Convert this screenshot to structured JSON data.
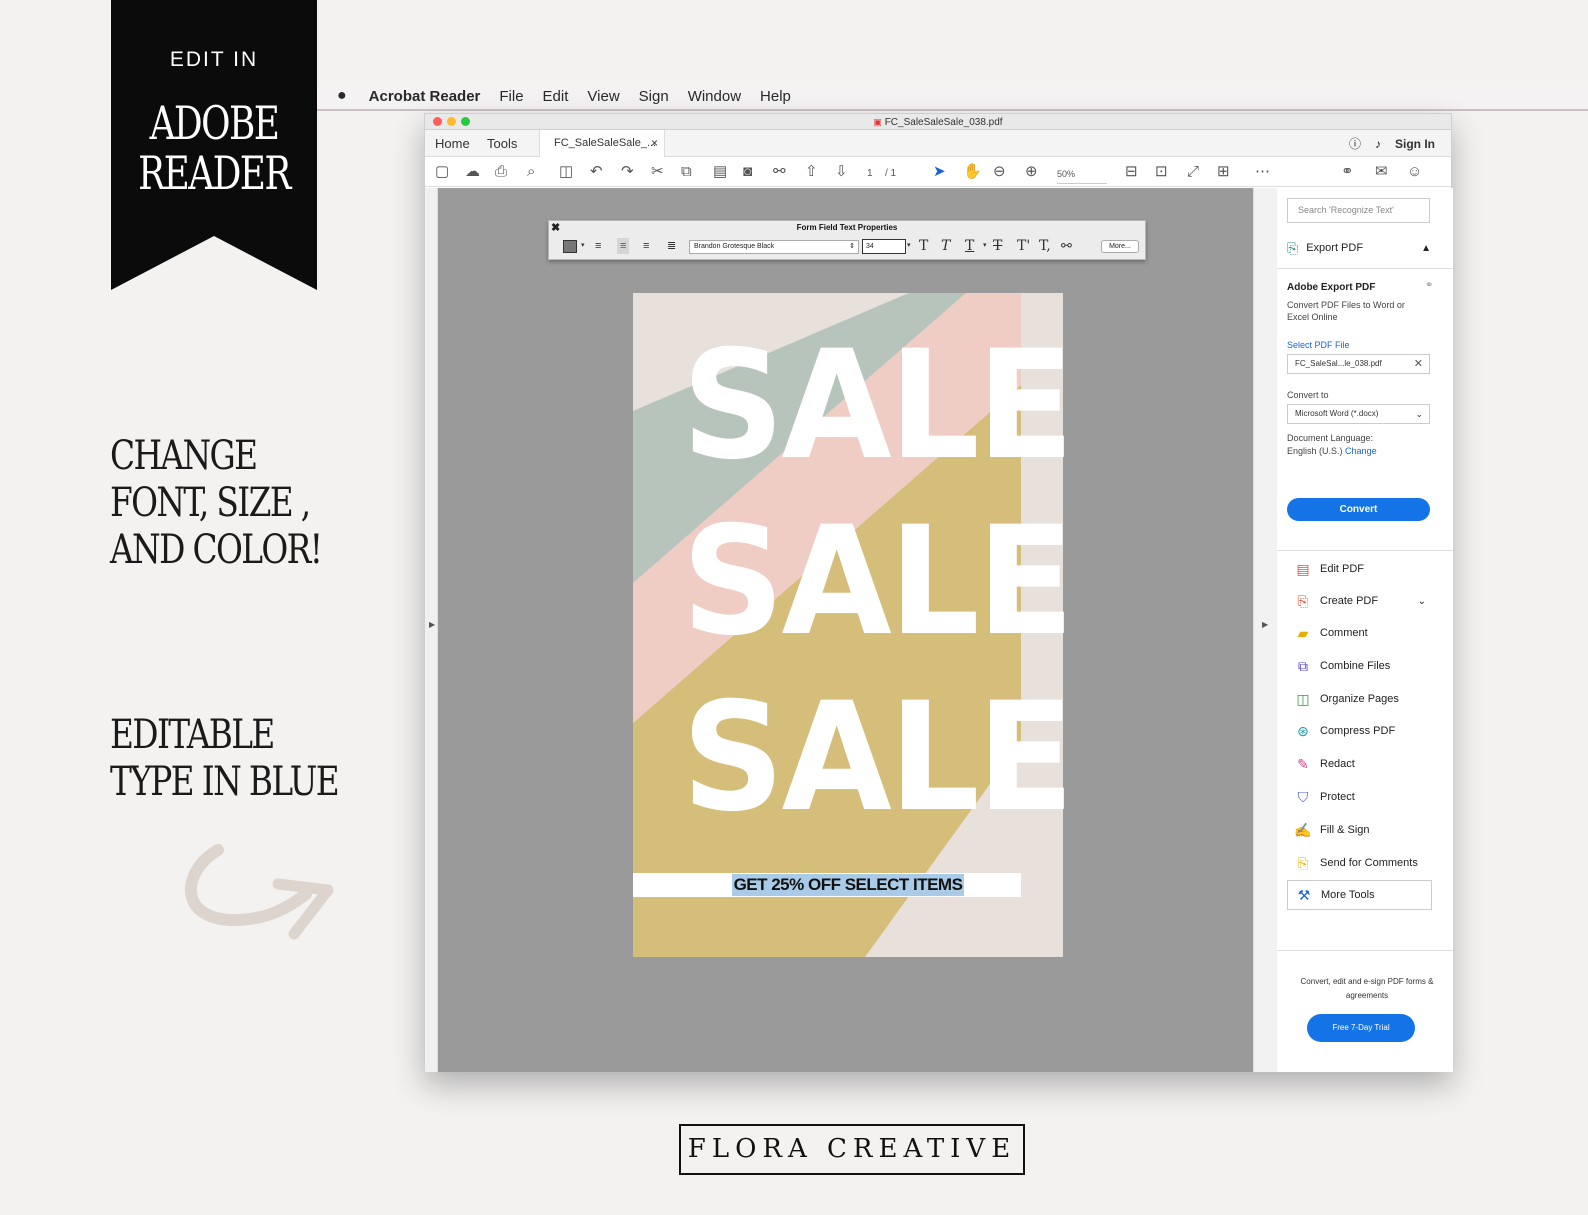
{
  "banner": {
    "edit_in": "EDIT IN",
    "line1": "ADOBE",
    "line2": "READER"
  },
  "left": {
    "feature1": "CHANGE\nFONT, SIZE ,\nAND COLOR!",
    "feature2": "EDITABLE\nTYPE IN BLUE"
  },
  "menubar": {
    "app": "Acrobat Reader",
    "items": [
      "File",
      "Edit",
      "View",
      "Sign",
      "Window",
      "Help"
    ]
  },
  "window": {
    "title": "FC_SaleSaleSale_038.pdf",
    "tabs": {
      "home": "Home",
      "tools": "Tools",
      "doc": "FC_SaleSaleSale_..."
    },
    "sign_in": "Sign In",
    "page_current": "1",
    "page_total": "/ 1",
    "zoom": "50%"
  },
  "palette": {
    "title": "Form Field Text Properties",
    "font": "Brandon Grotesque Black",
    "size": "34",
    "more": "More..."
  },
  "document": {
    "word": "SALE",
    "promo": "GET 25% OFF SELECT ITEMS",
    "colors": {
      "bg": "#e8e0da",
      "sage": "#b7c4bb",
      "pink": "#efcdc4",
      "gold": "#d5bd7a"
    }
  },
  "panel": {
    "search_placeholder": "Search 'Recognize Text'",
    "export_pdf": "Export PDF",
    "adobe_export": "Adobe Export PDF",
    "adobe_export_desc": "Convert PDF Files to Word or Excel Online",
    "select_file": "Select PDF File",
    "file_name": "FC_SaleSal...le_038.pdf",
    "convert_to": "Convert to",
    "format": "Microsoft Word (*.docx)",
    "doc_language_label": "Document Language:",
    "doc_language": "English (U.S.)",
    "change": "Change",
    "convert": "Convert",
    "tools": [
      {
        "label": "Edit PDF"
      },
      {
        "label": "Create PDF"
      },
      {
        "label": "Comment"
      },
      {
        "label": "Combine Files"
      },
      {
        "label": "Organize Pages"
      },
      {
        "label": "Compress PDF"
      },
      {
        "label": "Redact"
      },
      {
        "label": "Protect"
      },
      {
        "label": "Fill & Sign"
      },
      {
        "label": "Send for Comments"
      },
      {
        "label": "More Tools"
      }
    ],
    "promo": "Convert, edit and e-sign PDF forms & agreements",
    "trial": "Free 7-Day Trial"
  },
  "footer": {
    "brand": "FLORA CREATIVE"
  }
}
